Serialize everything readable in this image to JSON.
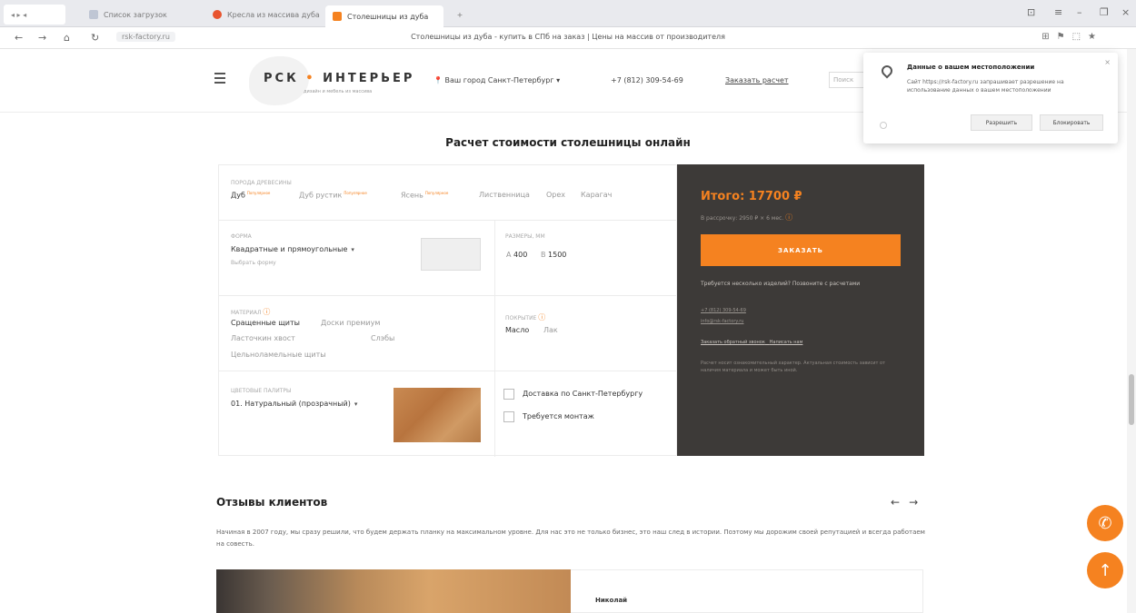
{
  "browser": {
    "tabs": [
      {
        "label": "Список загрузок",
        "active": false
      },
      {
        "label": "Кресла из массива дуба",
        "active": false
      },
      {
        "label": "Столешницы из дуба",
        "active": true
      }
    ],
    "add_tab": "+",
    "page_title": "Столешницы из дуба - купить в СПб на заказ | Цены на массив от производителя",
    "url": "rsk-factory.ru",
    "nav": {
      "back": "←",
      "forward": "→",
      "reload": "↻"
    },
    "window_controls": {
      "menu": "≡",
      "minimize": "–",
      "close": "×"
    }
  },
  "header": {
    "logo_left": "РСК",
    "logo_right": "ИНТЕРЬЕР",
    "logo_sub": "дизайн и мебель из массива",
    "city": "Ваш город Санкт-Петербург",
    "phone": "+7 (812) 309-54-69",
    "order_calc": "Заказать расчет",
    "search_placeholder": "Поиск"
  },
  "geo_popup": {
    "title": "Данные о вашем местоположении",
    "site": "Сайт https://rsk-factory.ru запрашивает разрешение на использование данных о вашем местоположении",
    "allow": "Разрешить",
    "block": "Блокировать",
    "close": "×"
  },
  "calc": {
    "title": "Расчет стоимости столешницы онлайн",
    "wood": {
      "label": "ПОРОДА ДРЕВЕСИНЫ",
      "options": [
        "Дуб",
        "Дуб рустик",
        "Ясень",
        "Лиственница",
        "Орех",
        "Карагач"
      ],
      "selected": "Дуб",
      "badge": "Популярное"
    },
    "shape": {
      "label": "ФОРМА",
      "value": "Квадратные и прямоугольные",
      "sub": "Выбрать форму"
    },
    "size": {
      "label": "РАЗМЕРЫ, ММ",
      "a": "400",
      "b": "1500"
    },
    "material": {
      "label": "МАТЕРИАЛ",
      "options": [
        "Сращенные щиты",
        "Доски премиум",
        "Ласточкин хвост",
        "Слэбы",
        "Цельноламельные щиты"
      ],
      "selected": "Сращенные щиты"
    },
    "coating": {
      "label": "ПОКРЫТИЕ",
      "options": [
        "Масло",
        "Лак"
      ],
      "selected": "Масло"
    },
    "finish": {
      "label": "ЦВЕТОВЫЕ ПАЛИТРЫ",
      "value": "01. Натуральный (прозрачный)"
    },
    "delivery": "Доставка по Санкт-Петербургу",
    "mounting": "Требуется монтаж",
    "total": "Итого: 17700 ₽",
    "installment": "В рассрочку: 2950 ₽ × 6 мес.",
    "order_btn": "ЗАКАЗАТЬ",
    "need_more": "Требуется несколько изделий? Позвоните с расчетами",
    "contact_phone": "+7 (812) 309-54-69",
    "contact_email": "info@rsk-factory.ru",
    "link_callback": "Заказать обратный звонок",
    "link_write": "Написать нам",
    "disclaimer": "Расчет носит ознакомительный характер. Актуальная стоимость зависит от наличия материала и может быть иной."
  },
  "reviews": {
    "title": "Отзывы клиентов",
    "prev": "←",
    "next": "→",
    "desc": "Начиная в 2007 году, мы сразу решили, что будем держать планку на максимальном уровне. Для нас это не только бизнес, это наш след в истории. Поэтому мы дорожим своей репутацией и всегда работаем на совесть.",
    "first_name": "Николай"
  },
  "floating": {
    "call_icon": "✆",
    "up_icon": "↑"
  }
}
